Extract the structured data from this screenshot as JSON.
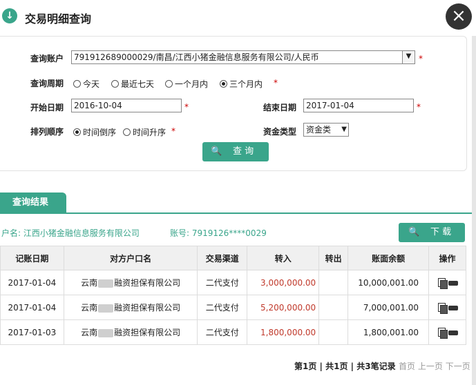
{
  "dialog": {
    "title": "交易明细查询",
    "title_icon": "download-circle-icon",
    "close_icon": "close-icon",
    "accent_color": "#3aa58b"
  },
  "form": {
    "account_label": "查询账户",
    "account_value": "791912689000029/南昌/江西小猪金融信息服务有限公司/人民币",
    "period_label": "查询周期",
    "period_options": [
      "今天",
      "最近七天",
      "一个月内",
      "三个月内"
    ],
    "period_selected": "三个月内",
    "start_label": "开始日期",
    "start_value": "2016-10-04",
    "end_label": "结束日期",
    "end_value": "2017-01-04",
    "order_label": "排列顺序",
    "order_options": [
      "时间倒序",
      "时间升序"
    ],
    "order_selected": "时间倒序",
    "fund_type_label": "资金类型",
    "fund_type_value": "资金类",
    "required_mark": "*",
    "query_button": "查 询"
  },
  "results": {
    "tab_label": "查询结果",
    "account_name": "户名: 江西小猪金融信息服务有限公司",
    "account_no": "账号: 7919126****0029",
    "download_button": "下 载",
    "columns": [
      "记账日期",
      "对方户口名",
      "交易渠道",
      "转入",
      "转出",
      "账面余额",
      "操作"
    ],
    "rows": [
      {
        "date": "2017-01-04",
        "counterparty_prefix": "云南",
        "counterparty_suffix": "融资担保有限公司",
        "channel": "二代支付",
        "in": "3,000,000.00",
        "out": "",
        "balance": "10,000,001.00"
      },
      {
        "date": "2017-01-04",
        "counterparty_prefix": "云南",
        "counterparty_suffix": "融资担保有限公司",
        "channel": "二代支付",
        "in": "5,200,000.00",
        "out": "",
        "balance": "7,000,001.00"
      },
      {
        "date": "2017-01-03",
        "counterparty_prefix": "云南",
        "counterparty_suffix": "融资担保有限公司",
        "channel": "二代支付",
        "in": "1,800,000.00",
        "out": "",
        "balance": "1,800,001.00"
      }
    ],
    "row_action_icons": [
      "copy-icon",
      "print-icon"
    ]
  },
  "pager": {
    "page_info": "第1页",
    "sep1": " | ",
    "total_pages": "共1页",
    "sep2": " | ",
    "total_records": "共3笔记录",
    "first": "首页",
    "prev": "上一页",
    "next": "下一页"
  }
}
